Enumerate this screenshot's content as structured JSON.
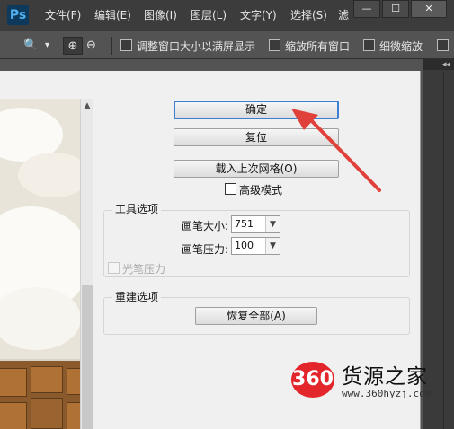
{
  "app": {
    "logo": "Ps",
    "menu": [
      "文件(F)",
      "编辑(E)",
      "图像(I)",
      "图层(L)",
      "文字(Y)",
      "选择(S)",
      "滤"
    ],
    "window_controls": [
      "—",
      "☐",
      "✕"
    ]
  },
  "options_bar": {
    "tools": [
      "🔍",
      "▾",
      "⊕",
      "⊖"
    ],
    "checkboxes": [
      "调整窗口大小以满屏显示",
      "缩放所有窗口",
      "细微缩放"
    ],
    "panel_tab": "◂◂"
  },
  "dialog": {
    "buttons": {
      "ok": "确定",
      "reset": "复位",
      "load_last_mesh": "载入上次网格(O)",
      "restore_all": "恢复全部(A)"
    },
    "advanced_mode_label": "高级模式",
    "tool_options": {
      "title": "工具选项",
      "brush_size_label": "画笔大小:",
      "brush_size_value": "751",
      "brush_pressure_label": "画笔压力:",
      "brush_pressure_value": "100",
      "stylus_pressure_label": "光笔压力"
    },
    "reconstruct_options": {
      "title": "重建选项"
    }
  },
  "watermark": {
    "logo_text": "360",
    "title": "货源之家",
    "url": "www.360hyzj.com"
  },
  "colors": {
    "annotation_arrow": "#e0413a",
    "primary_border": "#3a7fd0"
  }
}
